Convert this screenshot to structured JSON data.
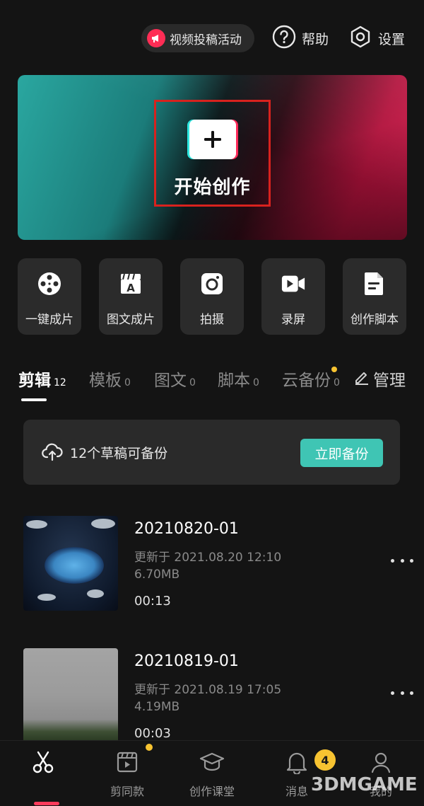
{
  "header": {
    "promo_label": "视频投稿活动",
    "help_label": "帮助",
    "settings_label": "设置"
  },
  "hero": {
    "start_label": "开始创作"
  },
  "tools": [
    {
      "label": "一键成片",
      "icon": "film-reel-icon"
    },
    {
      "label": "图文成片",
      "icon": "clapboard-text-icon"
    },
    {
      "label": "拍摄",
      "icon": "camera-icon"
    },
    {
      "label": "录屏",
      "icon": "screen-record-icon"
    },
    {
      "label": "创作脚本",
      "icon": "script-document-icon"
    }
  ],
  "tabs": [
    {
      "name": "剪辑",
      "count": "12",
      "active": true
    },
    {
      "name": "模板",
      "count": "0"
    },
    {
      "name": "图文",
      "count": "0"
    },
    {
      "name": "脚本",
      "count": "0"
    },
    {
      "name": "云备份",
      "count": "0"
    }
  ],
  "manage_label": "管理",
  "backup": {
    "text": "12个草稿可备份",
    "button": "立即备份"
  },
  "drafts": [
    {
      "title": "20210820-01",
      "updated": "更新于 2021.08.20 12:10",
      "size": "6.70MB",
      "duration": "00:13"
    },
    {
      "title": "20210819-01",
      "updated": "更新于 2021.08.19 17:05",
      "size": "4.19MB",
      "duration": "00:03"
    }
  ],
  "bottom_nav": [
    {
      "label": "",
      "icon": "scissors-icon",
      "active": true
    },
    {
      "label": "剪同款",
      "icon": "template-clapper-icon"
    },
    {
      "label": "创作课堂",
      "icon": "graduation-cap-icon"
    },
    {
      "label": "消息",
      "icon": "bell-icon",
      "badge": "4"
    },
    {
      "label": "我的",
      "icon": "profile-icon"
    }
  ],
  "watermark": "3DMGAME",
  "colors": {
    "background": "#141414",
    "accent_teal": "#3fc5b4",
    "accent_red": "#ff3b5c",
    "badge_yellow": "#f7c331"
  }
}
